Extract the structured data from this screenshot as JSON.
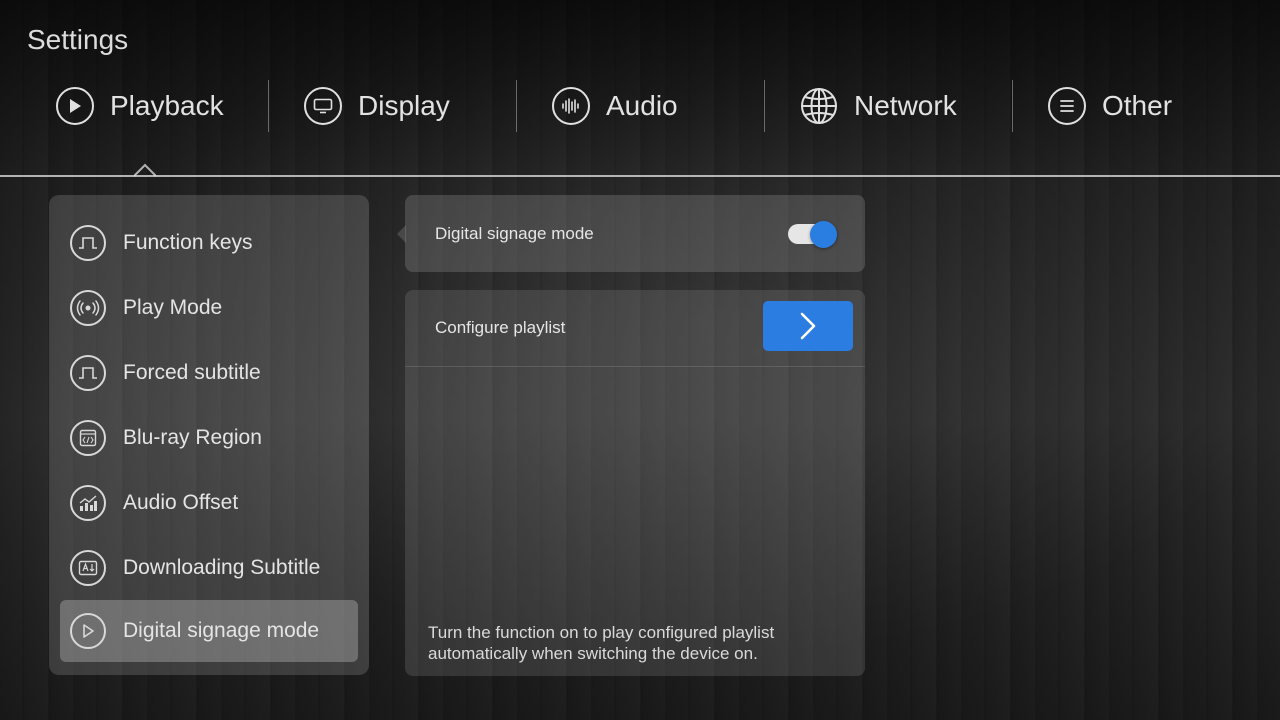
{
  "app": {
    "title": "Settings"
  },
  "tabs": [
    {
      "label": "Playback",
      "icon": "play-icon"
    },
    {
      "label": "Display",
      "icon": "monitor-icon"
    },
    {
      "label": "Audio",
      "icon": "audio-wave-icon"
    },
    {
      "label": "Network",
      "icon": "globe-icon"
    },
    {
      "label": "Other",
      "icon": "menu-lines-icon"
    }
  ],
  "sidebar": {
    "items": [
      {
        "label": "Function keys",
        "icon": "pulse-square-icon"
      },
      {
        "label": "Play Mode",
        "icon": "broadcast-icon"
      },
      {
        "label": "Forced subtitle",
        "icon": "pulse-square-icon"
      },
      {
        "label": "Blu-ray Region",
        "icon": "code-window-icon"
      },
      {
        "label": "Audio Offset",
        "icon": "chart-trend-icon"
      },
      {
        "label": "Downloading Subtitle",
        "icon": "download-box-icon"
      },
      {
        "label": "Digital signage mode",
        "icon": "play-icon",
        "selected": true
      }
    ]
  },
  "detail": {
    "toggle_label": "Digital signage mode",
    "toggle_on": true,
    "playlist_label": "Configure playlist",
    "hint": "Turn the function on to play configured playlist automatically when switching the device on."
  },
  "colors": {
    "accent": "#2b7de2",
    "text": "#e4e4e4"
  }
}
